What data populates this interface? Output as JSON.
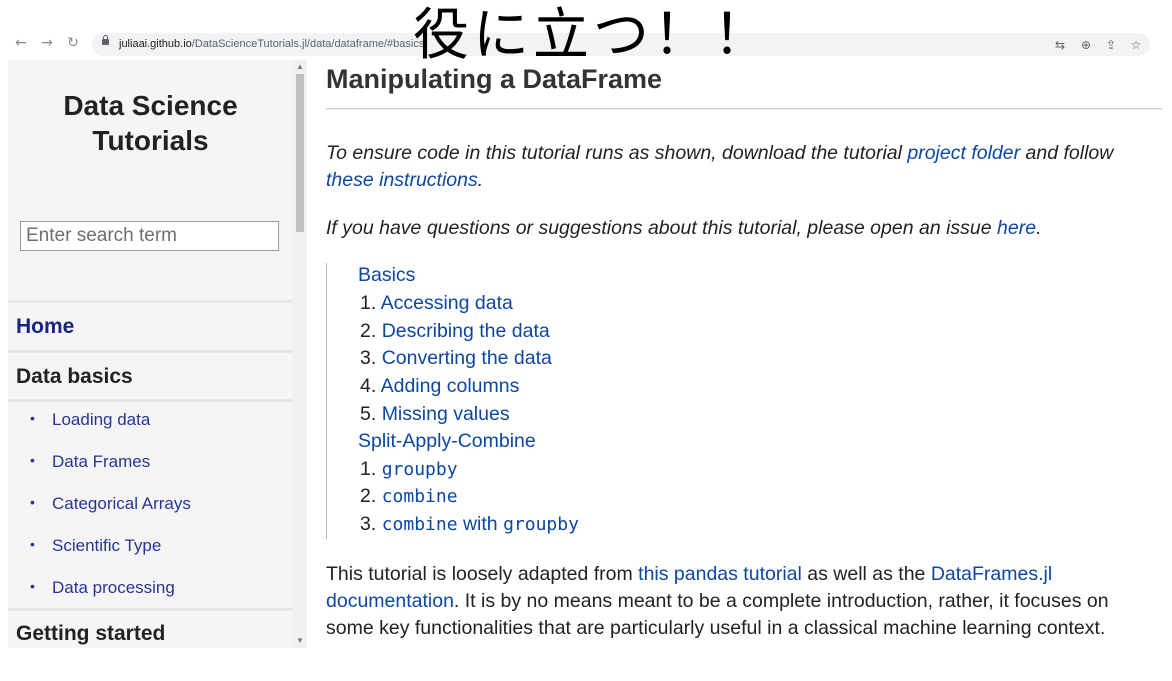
{
  "browser": {
    "url_host": "juliaai.github.io",
    "url_path": "/DataScienceTutorials.jl/data/dataframe/#basics"
  },
  "overlay": {
    "caption": "役に立つ！！"
  },
  "sidebar": {
    "site_title_line1": "Data Science",
    "site_title_line2": "Tutorials",
    "search_placeholder": "Enter search term",
    "home": "Home",
    "section_data_basics": "Data basics",
    "items": [
      "Loading data",
      "Data Frames",
      "Categorical Arrays",
      "Scientific Type",
      "Data processing"
    ],
    "section_getting_started": "Getting started"
  },
  "content": {
    "title": "Manipulating a DataFrame",
    "intro_prefix": "To ensure code in this tutorial runs as shown, download the tutorial ",
    "link_project_folder": "project folder",
    "intro_mid": " and follow",
    "link_these_instructions": "these instructions",
    "intro_end": ".",
    "questions_prefix": "If you have questions or suggestions about this tutorial, please open an issue ",
    "link_here": "here",
    "questions_end": ".",
    "toc": {
      "basics_heading": "Basics",
      "basics_nums": [
        "1.",
        "2.",
        "3.",
        "4.",
        "5."
      ],
      "basics_items": [
        "Accessing data",
        "Describing the data",
        "Converting the data",
        "Adding columns",
        "Missing values"
      ],
      "sac_heading": "Split-Apply-Combine",
      "sac_nums": [
        "1.",
        "2.",
        "3."
      ],
      "sac_code_1": "groupby",
      "sac_code_2": "combine",
      "sac_code_3a": "combine",
      "sac_mid_3": " with ",
      "sac_code_3b": "groupby"
    },
    "outro_prefix": "This tutorial is loosely adapted from ",
    "link_pandas": "this pandas tutorial",
    "outro_mid": " as well as the ",
    "link_dataframes_1": "DataFrames.jl",
    "link_dataframes_2": "documentation",
    "outro_line2_rest": ". It is by no means meant to be a complete introduction, rather, it focuses on",
    "outro_line3": "some key functionalities that are particularly useful in a classical machine learning context."
  },
  "icons": {
    "back": "arrow-left-icon",
    "forward": "arrow-right-icon",
    "reload": "reload-icon",
    "translate": "translate-icon",
    "zoom": "zoom-icon",
    "share": "share-icon",
    "bookmark": "star-icon"
  }
}
